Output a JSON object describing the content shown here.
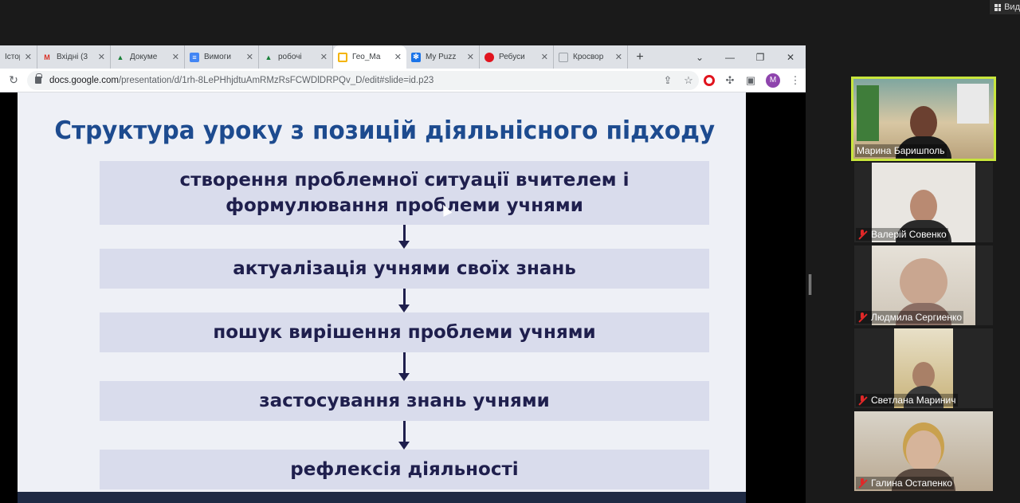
{
  "view_control": {
    "label": "Вид"
  },
  "browser": {
    "tabs": [
      {
        "label": "Історі",
        "icon": "page-icon",
        "color": "#9aa0a6"
      },
      {
        "label": "Вхідні (3",
        "icon": "gmail-icon",
        "color": "#d93025"
      },
      {
        "label": "Докуме",
        "icon": "drive-icon",
        "color": "#188038"
      },
      {
        "label": "Вимоги",
        "icon": "docs-icon",
        "color": "#4285f4"
      },
      {
        "label": "робочі",
        "icon": "drive-icon",
        "color": "#188038"
      },
      {
        "label": "Гео_Ма",
        "icon": "slides-icon",
        "color": "#f4b400",
        "active": true
      },
      {
        "label": "My Puzz",
        "icon": "puzzle-icon",
        "color": "#1a73e8"
      },
      {
        "label": "Ребуси",
        "icon": "opera-icon",
        "color": "#e1141e"
      },
      {
        "label": "Кросвор",
        "icon": "crossword-icon",
        "color": "#9aa0a6"
      }
    ],
    "new_tab": "+",
    "url_host": "docs.google.com",
    "url_path": "/presentation/d/1rh-8LePHhjdtuAmRMzRsFCWDlDRPQv_D/edit#slide=id.p23",
    "profile_initial": "M"
  },
  "slide": {
    "title": "Структура уроку з позицій діяльнісного підходу",
    "steps": [
      {
        "line1": "створення проблемної ситуації вчителем і",
        "line2": "формулювання проблеми учнями"
      },
      {
        "line1": "актуалізація учнями своїх знань"
      },
      {
        "line1": "пошук вирішення проблеми учнями"
      },
      {
        "line1": "застосування знань учнями"
      },
      {
        "line1": "рефлексія діяльності"
      }
    ]
  },
  "participants": [
    {
      "name": "Марина Баришполь",
      "muted": false,
      "active": true
    },
    {
      "name": "Валерій Совенко",
      "muted": true
    },
    {
      "name": "Людмила Сергиенко",
      "muted": true
    },
    {
      "name": "Светлана Маринич",
      "muted": true
    },
    {
      "name": "Галина Остапенко",
      "muted": true
    }
  ]
}
